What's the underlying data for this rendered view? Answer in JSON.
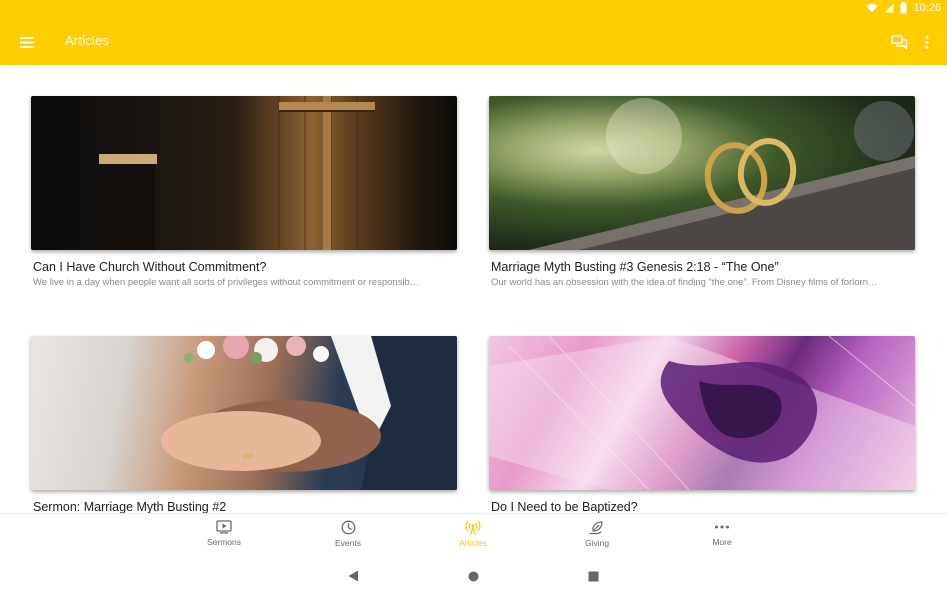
{
  "status_bar": {
    "time": "10:26"
  },
  "app_bar": {
    "title": "Articles"
  },
  "articles": [
    {
      "title": "Can I Have Church Without Commitment?",
      "description": "We live in a day when people want all sorts of privileges without commitment or responsib…"
    },
    {
      "title": "Marriage Myth Busting #3 Genesis 2:18 - “The One”",
      "description": "Our world has an obsession with the idea of finding “the one”. From Disney films of forlorn…"
    },
    {
      "title": "Sermon: Marriage Myth Busting #2",
      "description": ""
    },
    {
      "title": "Do I Need to be Baptized?",
      "description": ""
    }
  ],
  "bottom_nav": {
    "items": [
      {
        "label": "Sermons",
        "icon": "play-screen-icon"
      },
      {
        "label": "Events",
        "icon": "clock-icon"
      },
      {
        "label": "Articles",
        "icon": "broadcast-icon",
        "active": true
      },
      {
        "label": "Giving",
        "icon": "leaf-hand-icon"
      },
      {
        "label": "More",
        "icon": "more-horiz-icon"
      }
    ]
  },
  "colors": {
    "primary": "#FFCD00",
    "active_nav": "#FFC400"
  }
}
